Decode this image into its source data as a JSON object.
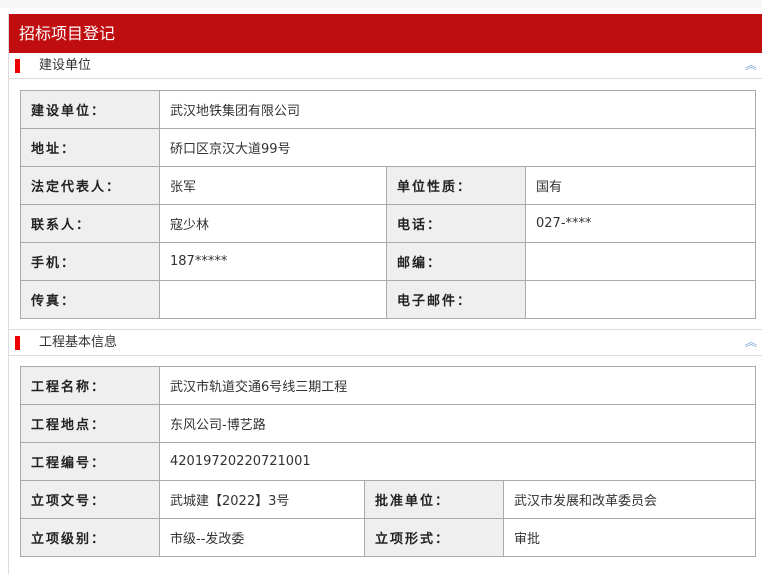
{
  "title": "招标项目登记",
  "sections": [
    {
      "label": "建设单位",
      "icon": "double-chevron-up-icon"
    },
    {
      "label": "工程基本信息",
      "icon": "double-chevron-up-icon"
    }
  ],
  "unit": {
    "name_label": "建设单位：",
    "name": "武汉地铁集团有限公司",
    "addr_label": "地址：",
    "addr": "硚口区京汉大道99号",
    "rep_label": "法定代表人：",
    "rep": "张军",
    "nature_label": "单位性质：",
    "nature": "国有",
    "contact_label": "联系人：",
    "contact": "寇少林",
    "phone_label": "电话：",
    "phone": "027-****",
    "mobile_label": "手机：",
    "mobile": "187*****",
    "zip_label": "邮编：",
    "zip": "",
    "fax_label": "传真：",
    "fax": "",
    "email_label": "电子邮件：",
    "email": ""
  },
  "project": {
    "name_label": "工程名称：",
    "name": "武汉市轨道交通6号线三期工程",
    "loc_label": "工程地点：",
    "loc": "东风公司-博艺路",
    "code_label": "工程编号：",
    "code": "42019720220721001",
    "doc_label": "立项文号：",
    "doc": "武城建【2022】3号",
    "approver_label": "批准单位：",
    "approver": "武汉市发展和改革委员会",
    "level_label": "立项级别：",
    "level": "市级--发改委",
    "form_label": "立项形式：",
    "form": "审批"
  }
}
